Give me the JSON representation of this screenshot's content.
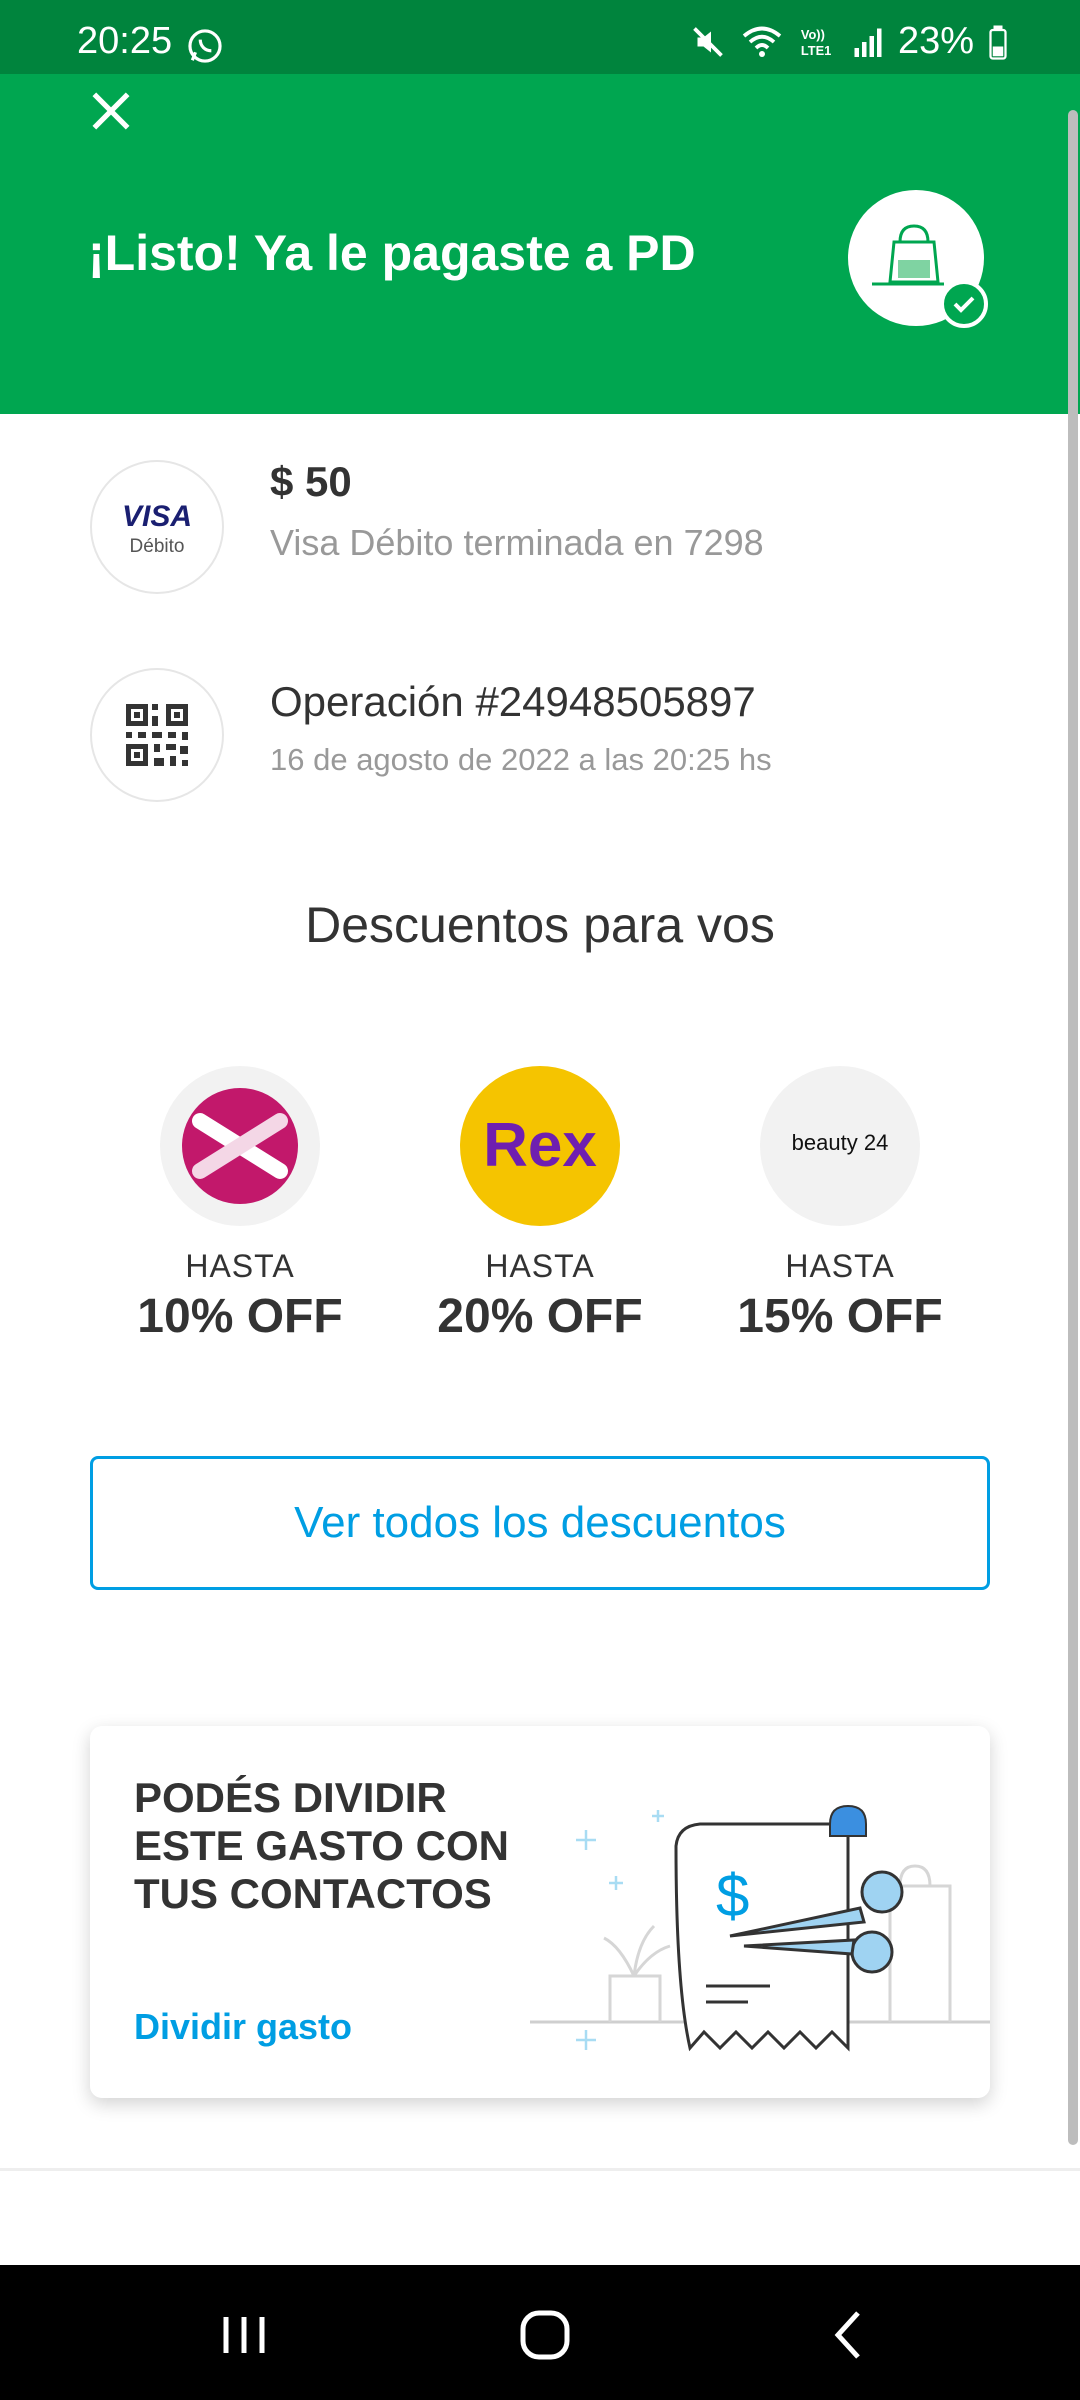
{
  "status_bar": {
    "time": "20:25",
    "battery": "23%",
    "icons": [
      "whatsapp-icon",
      "mute-icon",
      "wifi-icon",
      "volte-icon",
      "signal-icon",
      "battery-icon"
    ]
  },
  "header": {
    "title": "¡Listo! Ya le pagaste a PD",
    "bg_color": "#00a650"
  },
  "payment": {
    "card_logo_text": "VISA",
    "card_logo_sub": "Débito",
    "amount": "$ 50",
    "card_description": "Visa Débito terminada en 7298"
  },
  "operation": {
    "title": "Operación #24948505897",
    "date": "16 de agosto de 2022 a las 20:25 hs"
  },
  "discounts": {
    "title": "Descuentos para vos",
    "items": [
      {
        "logo": "x-logo",
        "logo_text": "",
        "hasta": "HASTA",
        "off": "10% OFF"
      },
      {
        "logo": "rex-logo",
        "logo_text": "Rex",
        "hasta": "HASTA",
        "off": "20% OFF"
      },
      {
        "logo": "beauty24-logo",
        "logo_text": "beauty 24",
        "hasta": "HASTA",
        "off": "15% OFF"
      }
    ],
    "button_label": "Ver todos los descuentos"
  },
  "split": {
    "title": "PODÉS DIVIDIR ESTE GASTO CON TUS CONTACTOS",
    "link_label": "Dividir gasto"
  },
  "colors": {
    "accent": "#009ee3",
    "green": "#00a650",
    "dark_green": "#00843d"
  }
}
